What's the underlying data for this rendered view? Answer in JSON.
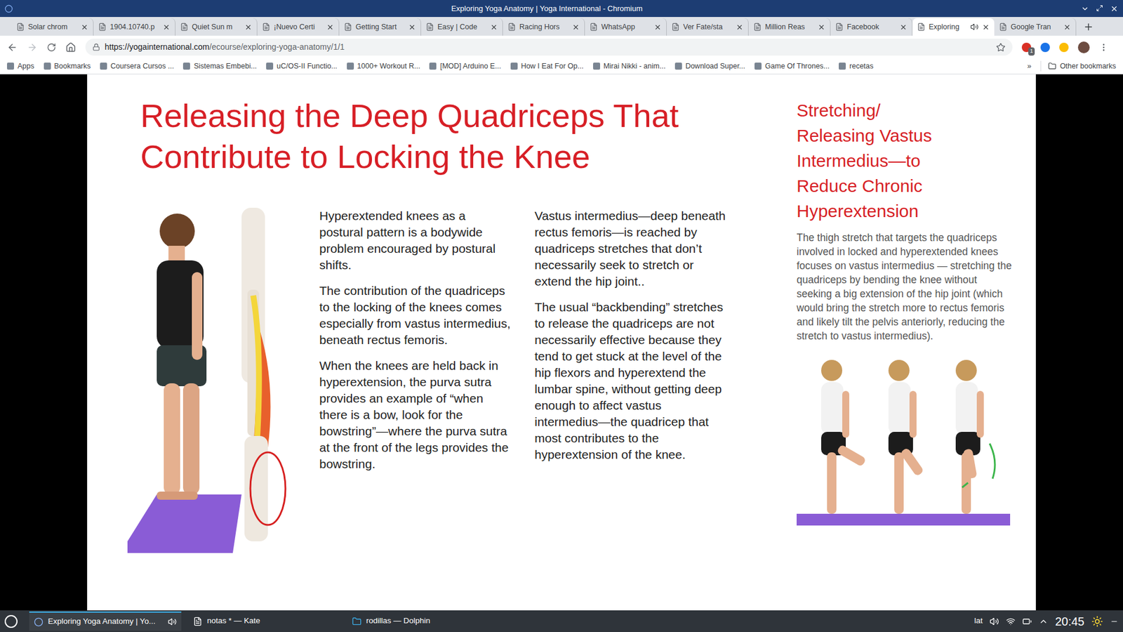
{
  "window": {
    "title": "Exploring Yoga Anatomy | Yoga International - Chromium"
  },
  "tabs": [
    {
      "label": "Solar chrom",
      "selected": false,
      "audio": false
    },
    {
      "label": "1904.10740.p",
      "selected": false,
      "audio": false
    },
    {
      "label": "Quiet Sun m",
      "selected": false,
      "audio": false
    },
    {
      "label": "¡Nuevo Certi",
      "selected": false,
      "audio": false
    },
    {
      "label": "Getting Start",
      "selected": false,
      "audio": false
    },
    {
      "label": "Easy | Code",
      "selected": false,
      "audio": false
    },
    {
      "label": "Racing Hors",
      "selected": false,
      "audio": false
    },
    {
      "label": "WhatsApp",
      "selected": false,
      "audio": false
    },
    {
      "label": "Ver Fate/sta",
      "selected": false,
      "audio": false
    },
    {
      "label": "Million Reas",
      "selected": false,
      "audio": false
    },
    {
      "label": "Facebook",
      "selected": false,
      "audio": false
    },
    {
      "label": "Exploring",
      "selected": true,
      "audio": true
    },
    {
      "label": "Google Tran",
      "selected": false,
      "audio": false
    }
  ],
  "address": {
    "host": "https://yogainternational.com",
    "path": "/ecourse/exploring-yoga-anatomy/1/1",
    "extension_badge": "1"
  },
  "bookmarks": {
    "items": [
      "Apps",
      "Bookmarks",
      "Coursera Cursos ...",
      "Sistemas Embebi...",
      "uC/OS-II Functio...",
      "1000+ Workout R...",
      "[MOD] Arduino E...",
      "How I Eat For Op...",
      "Mirai Nikki - anim...",
      "Download Super...",
      "Game Of Thrones...",
      "recetas"
    ],
    "more": "»",
    "other": "Other bookmarks"
  },
  "slide": {
    "title": "Releasing the Deep Quadriceps That Contribute to Locking the Knee",
    "columns": [
      [
        "Hyperextended knees as a postural pattern is a bodywide problem encouraged by postural shifts.",
        "The contribution of the quadriceps to the locking of the knees comes especially from vastus intermedius, beneath rectus femoris.",
        "When the knees are held back in hyperextension, the purva sutra provides an example of “when there is a bow, look for the bowstring”—where the purva sutra at the front of the legs provides the bowstring."
      ],
      [
        "Vastus intermedius—deep beneath rectus femoris—is reached by quadriceps stretches that don’t necessarily seek to stretch or extend the hip joint..",
        "The usual “backbending” stretches to release the quadriceps are not necessarily effective because they tend to get stuck at the level of the hip flexors and hyperextend the lumbar spine, without getting deep enough to affect vastus intermedius—the quadricep that most contributes to the hyperextension of the knee."
      ]
    ],
    "sidebar": {
      "heading": "Stretching/ Releasing Vastus Intermedius—to Reduce Chronic Hyperextension",
      "text": "The thigh stretch that targets the quadriceps involved in locked and hyperextended knees focuses on vastus intermedius — stretching the quadriceps by bending the knee without seeking a big extension of the hip joint (which would bring the stretch more to rectus femoris and likely tilt the pelvis anteriorly, reducing the stretch to vastus intermedius)."
    }
  },
  "taskbar": {
    "tasks": [
      {
        "label": "Exploring Yoga Anatomy | Yo...",
        "selected": true,
        "kind": "browser"
      },
      {
        "label": "notas * — Kate",
        "selected": false,
        "kind": "editor"
      },
      {
        "label": "rodillas — Dolphin",
        "selected": false,
        "kind": "files"
      }
    ],
    "layout": "lat",
    "clock": "20:45"
  }
}
